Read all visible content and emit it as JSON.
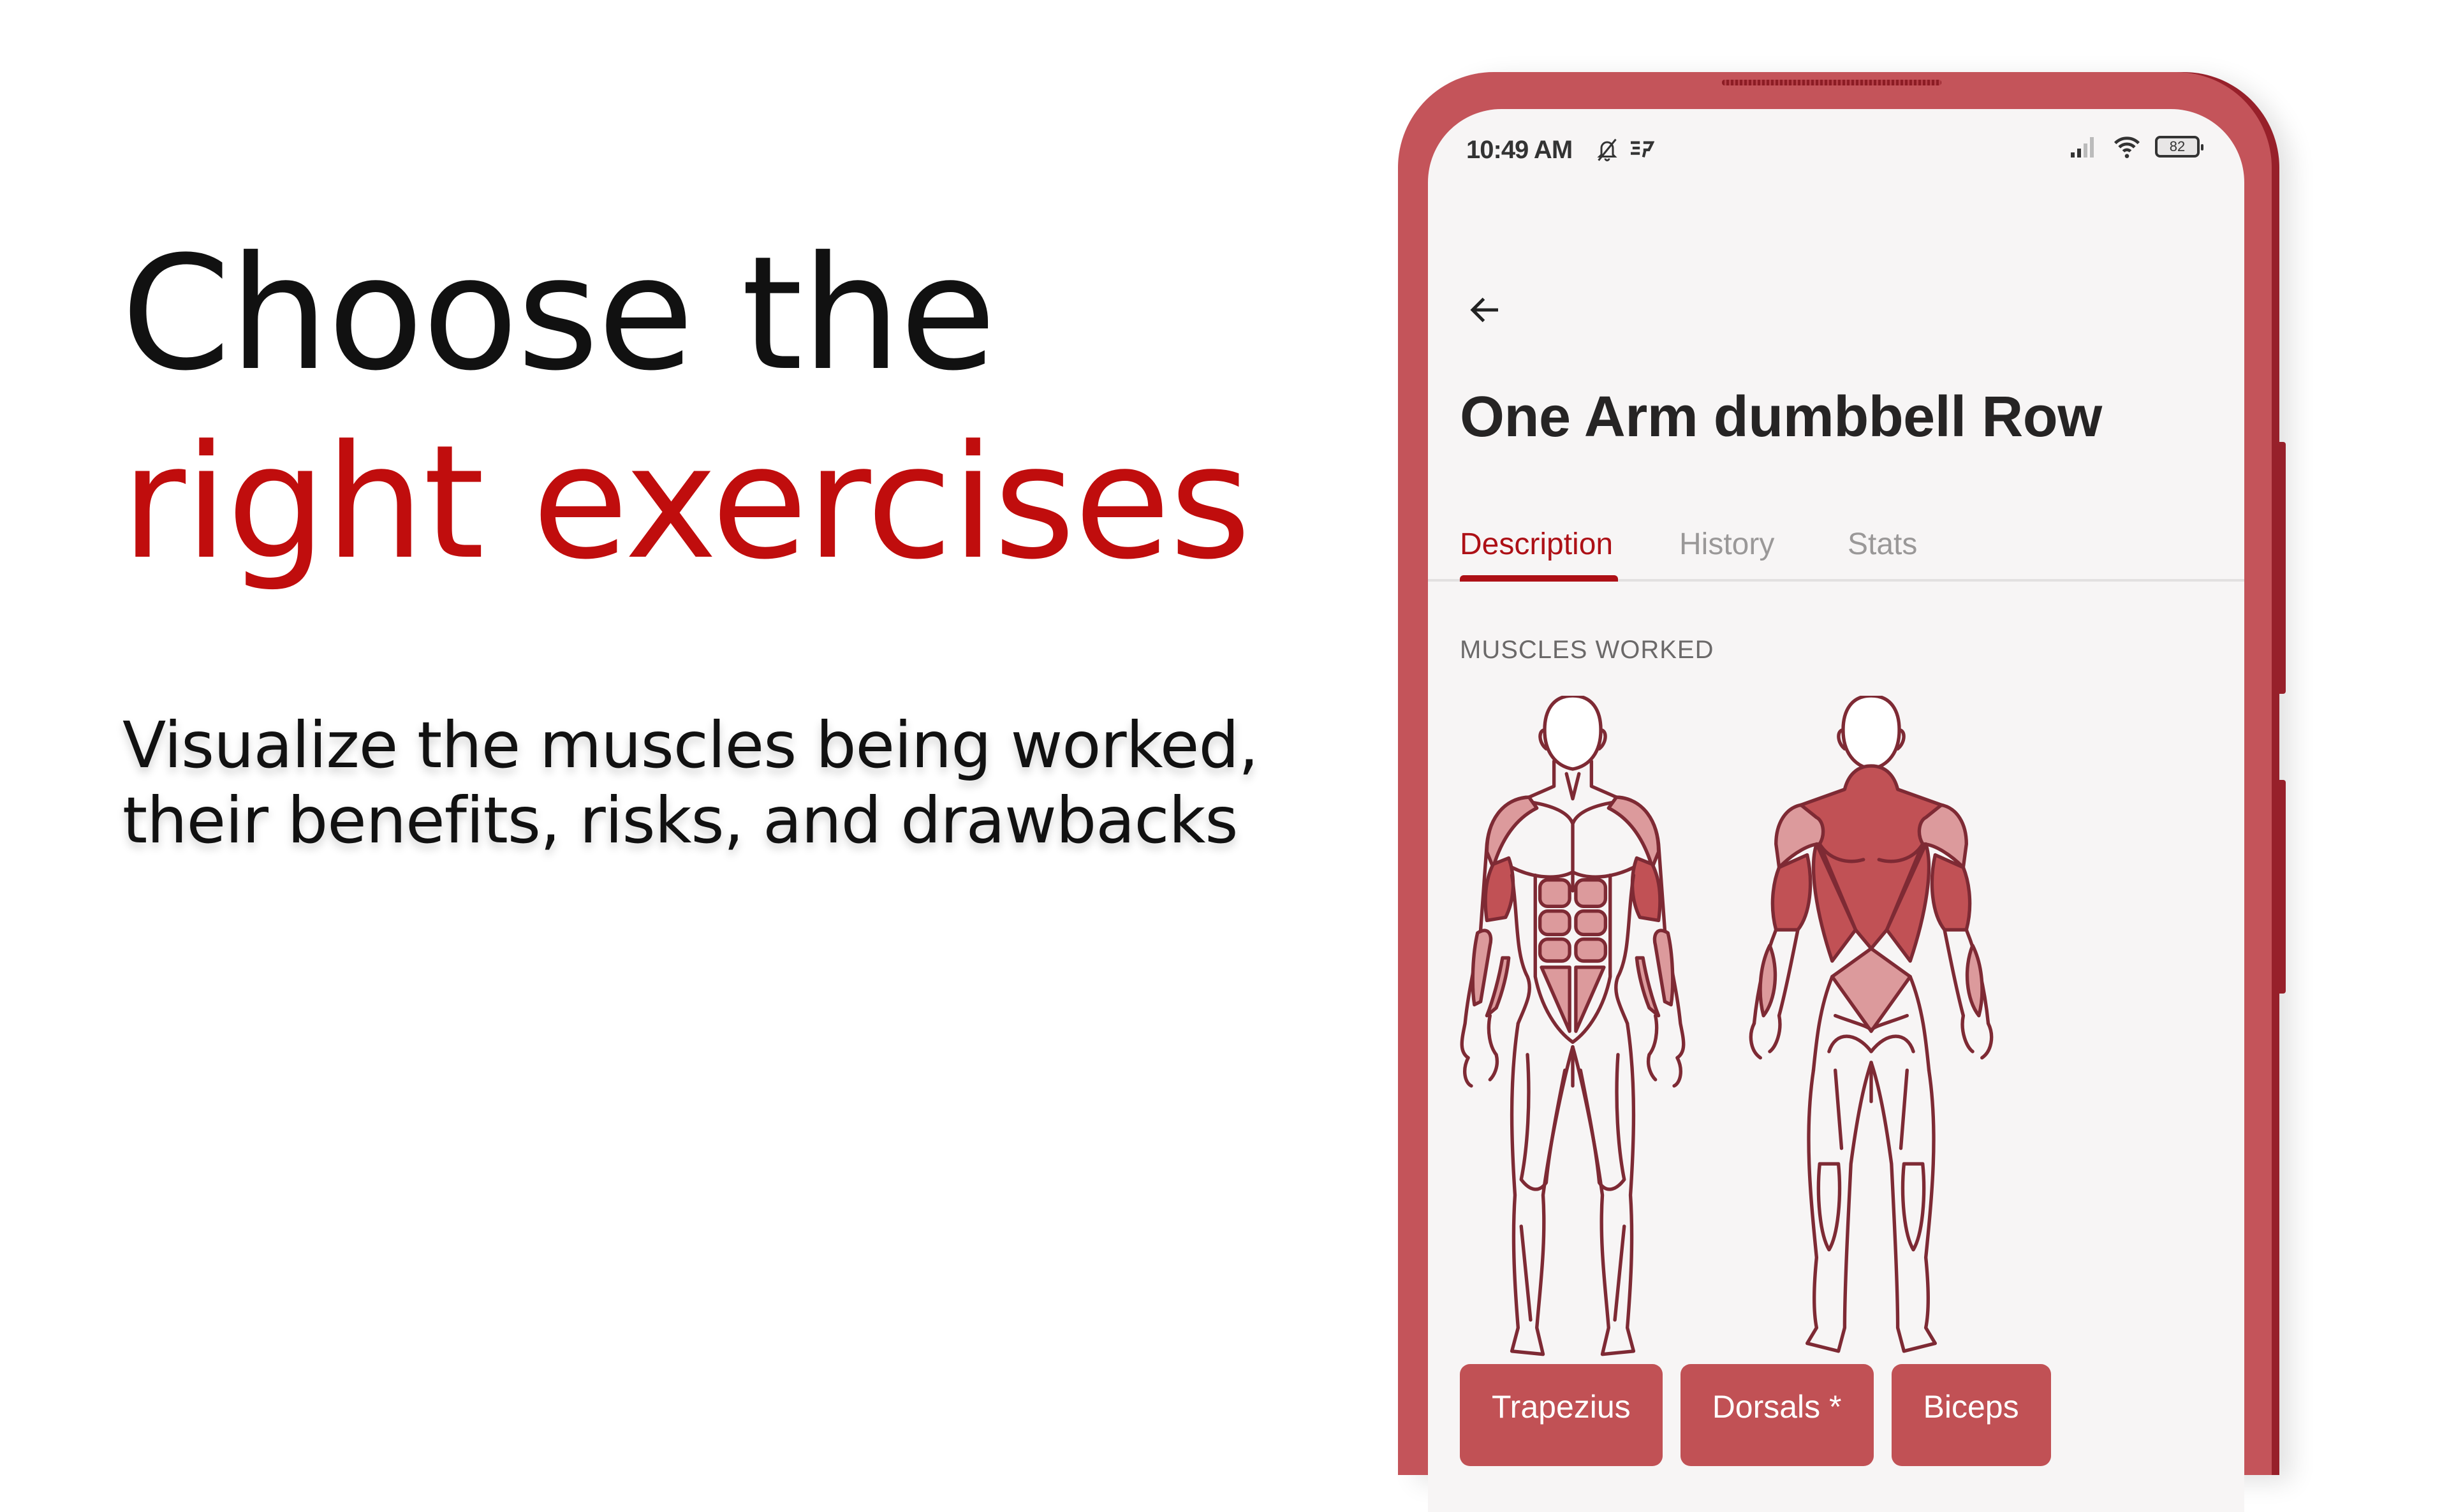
{
  "hero": {
    "title_line1": "Choose the",
    "title_line2": "right exercises",
    "subtitle_line1": "Visualize the muscles being worked,",
    "subtitle_line2": "their benefits, risks, and drawbacks"
  },
  "colors": {
    "accent": "#c00d0d",
    "phone_frame": "#c4545a",
    "tab_active": "#ad1016",
    "chip_bg": "#c15155",
    "muscle_primary": "#c15155",
    "muscle_secondary": "#dc9a9c",
    "outline": "#7e2a34"
  },
  "status_bar": {
    "time": "10:49 AM",
    "left_icons": [
      "bell-off-icon",
      "sp-icon"
    ],
    "sp_label": "5P",
    "right_icons": [
      "signal-icon",
      "wifi-icon",
      "battery-icon"
    ],
    "battery_level": "82"
  },
  "screen": {
    "back_icon": "arrow-left-icon",
    "title": "One Arm dumbbell Row",
    "tabs": [
      {
        "label": "Description",
        "active": true
      },
      {
        "label": "History",
        "active": false
      },
      {
        "label": "Stats",
        "active": false
      }
    ],
    "section_label": "MUSCLES WORKED",
    "muscle_chips": [
      "Trapezius",
      "Dorsals *",
      "Biceps"
    ]
  }
}
